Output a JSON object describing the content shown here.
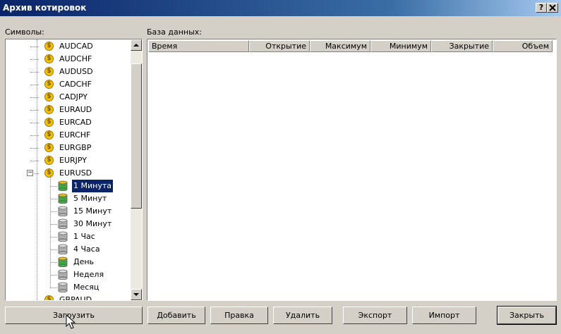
{
  "window": {
    "title": "Архив котировок",
    "help_label": "?",
    "close_label": "X"
  },
  "left_panel": {
    "label": "Символы:"
  },
  "right_panel": {
    "label": "База данных:"
  },
  "tree": {
    "symbols": [
      "AUDCAD",
      "AUDCHF",
      "AUDUSD",
      "CADCHF",
      "CADJPY",
      "EURAUD",
      "EURCAD",
      "EURCHF",
      "EURGBP",
      "EURJPY",
      "EURUSD"
    ],
    "expanded_symbol": "EURUSD",
    "timeframes": [
      {
        "label": "1 Минута",
        "state": "green",
        "selected": true
      },
      {
        "label": "5 Минут",
        "state": "green",
        "selected": false
      },
      {
        "label": "15 Минут",
        "state": "gray",
        "selected": false
      },
      {
        "label": "30 Минут",
        "state": "gray",
        "selected": false
      },
      {
        "label": "1 Час",
        "state": "gray",
        "selected": false
      },
      {
        "label": "4 Часа",
        "state": "gray",
        "selected": false
      },
      {
        "label": "День",
        "state": "green",
        "selected": false
      },
      {
        "label": "Неделя",
        "state": "gray",
        "selected": false
      },
      {
        "label": "Месяц",
        "state": "gray",
        "selected": false
      }
    ],
    "partial_next_symbol": "GBPAUD",
    "expand_toggle": "−",
    "coin_glyph": "$"
  },
  "grid": {
    "columns": [
      "Время",
      "Открытие",
      "Максимум",
      "Минимум",
      "Закрытие",
      "Объем"
    ]
  },
  "buttons": {
    "load": "Загрузить",
    "add": "Добавить",
    "edit": "Правка",
    "delete": "Удалить",
    "export": "Экспорт",
    "import": "Импорт",
    "close": "Закрыть"
  },
  "colors": {
    "title_start": "#0a246a",
    "title_end": "#a6caf0",
    "selection": "#0a246a",
    "coin": "#f2c200",
    "db_green": "#3cb43c",
    "db_gray": "#c0c0c0"
  }
}
